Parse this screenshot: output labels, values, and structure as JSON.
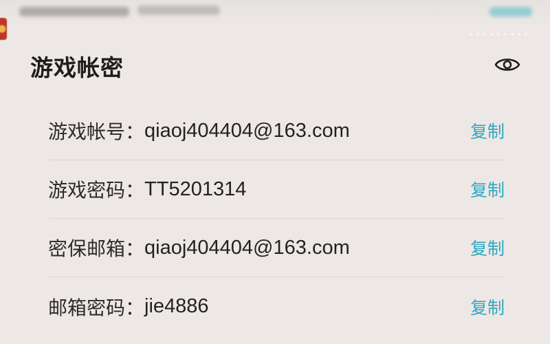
{
  "card": {
    "title": "游戏帐密",
    "visibility_icon": "eye-icon"
  },
  "rows": [
    {
      "label": "游戏帐号：",
      "value": "qiaoj404404@163.com",
      "action": "复制"
    },
    {
      "label": "游戏密码：",
      "value": "TT5201314",
      "action": "复制"
    },
    {
      "label": "密保邮箱：",
      "value": "qiaoj404404@163.com",
      "action": "复制"
    },
    {
      "label": "邮箱密码：",
      "value": "jie4886",
      "action": "复制"
    }
  ],
  "colors": {
    "background": "#ede8e5",
    "accent": "#2fa9c2",
    "text": "#222222"
  }
}
